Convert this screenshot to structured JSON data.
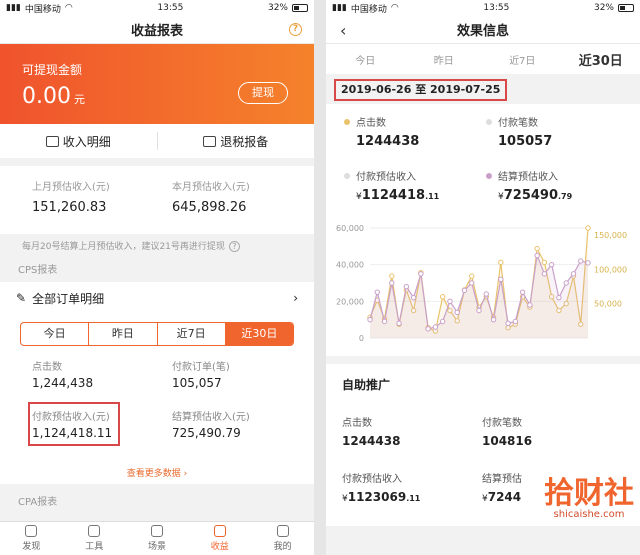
{
  "left": {
    "status": {
      "carrier": "中国移动",
      "time": "13:55",
      "battery": "32%"
    },
    "title": "收益报表",
    "help_icon": "question-circle-icon",
    "banner": {
      "label": "可提现金额",
      "amount": "0.00",
      "unit": "元",
      "button": "提现"
    },
    "links": [
      {
        "label": "收入明细",
        "icon": "wallet-icon"
      },
      {
        "label": "退税报备",
        "icon": "mail-icon"
      }
    ],
    "estimate": {
      "last_month_label": "上月预估收入(元)",
      "last_month_value": "151,260.83",
      "this_month_label": "本月预估收入(元)",
      "this_month_value": "645,898.26"
    },
    "note": "每月20号结算上月预估收入，建议21号再进行提现",
    "cps_label": "CPS报表",
    "all_orders": "全部订单明细",
    "tabs": [
      "今日",
      "昨日",
      "近7日",
      "近30日"
    ],
    "active_tab": 3,
    "stats": {
      "clicks_label": "点击数",
      "clicks": "1,244,438",
      "orders_label": "付款订单(笔)",
      "orders": "105,057",
      "pay_income_label": "付款预估收入(元)",
      "pay_income": "1,124,418.11",
      "settle_income_label": "结算预估收入(元)",
      "settle_income": "725,490.79"
    },
    "more": "查看更多数据",
    "cpa_label": "CPA报表",
    "tabbar": [
      {
        "label": "发现",
        "icon": "compass-icon"
      },
      {
        "label": "工具",
        "icon": "toolbox-icon"
      },
      {
        "label": "场景",
        "icon": "grid-icon"
      },
      {
        "label": "收益",
        "icon": "chart-icon"
      },
      {
        "label": "我的",
        "icon": "user-icon"
      }
    ],
    "active_tabbar": 3
  },
  "right": {
    "status": {
      "carrier": "中国移动",
      "time": "13:55",
      "battery": "32%"
    },
    "title": "效果信息",
    "tabs": [
      "今日",
      "昨日",
      "近7日",
      "近30日"
    ],
    "active_tab": 3,
    "date_range": "2019-06-26 至 2019-07-25",
    "metrics": {
      "clicks_label": "点击数",
      "clicks": "1244438",
      "orders_label": "付款笔数",
      "orders": "105057",
      "pay_label": "付款预估收入",
      "pay_int": "1124418",
      "pay_dec": ".11",
      "settle_label": "结算预估收入",
      "settle_int": "725490",
      "settle_dec": ".79",
      "currency": "¥"
    },
    "self_promo": {
      "title": "自助推广",
      "clicks_label": "点击数",
      "clicks": "1244438",
      "orders_label": "付款笔数",
      "orders": "104816",
      "pay_label": "付款预估收入",
      "pay_int": "1123069",
      "pay_dec": ".11",
      "settle_label": "结算预估",
      "settle_int": "7244",
      "currency": "¥"
    },
    "watermark": {
      "big": "拾财社",
      "small": "shicaishe.com"
    }
  },
  "colors": {
    "accent": "#f0642d",
    "highlight": "#d94848",
    "orange": "#e9a23b",
    "purple": "#c9a0c9"
  },
  "chart_data": {
    "type": "line",
    "left_axis": {
      "ticks": [
        "60,000",
        "40,000",
        "20,000",
        "0"
      ],
      "ylim": [
        0,
        60000
      ]
    },
    "right_axis": {
      "ticks": [
        "150,000",
        "100,000",
        "50,000"
      ],
      "ylim": [
        0,
        160000
      ]
    },
    "series": [
      {
        "name": "点击数",
        "color": "#e9c26a",
        "axis": "right",
        "values": [
          30000,
          55000,
          28000,
          90000,
          20000,
          70000,
          40000,
          95000,
          15000,
          10000,
          60000,
          40000,
          25000,
          70000,
          90000,
          45000,
          60000,
          30000,
          110000,
          15000,
          20000,
          60000,
          45000,
          130000,
          110000,
          60000,
          40000,
          50000,
          90000,
          20000,
          160000
        ]
      },
      {
        "name": "结算预估收入",
        "color": "#c9a0c9",
        "axis": "left",
        "values": [
          10000,
          25000,
          9000,
          30000,
          8000,
          28000,
          22000,
          35000,
          5000,
          6000,
          9000,
          20000,
          14000,
          26000,
          30000,
          15000,
          24000,
          10000,
          32000,
          8000,
          9000,
          25000,
          18000,
          45000,
          35000,
          40000,
          22000,
          30000,
          35000,
          42000,
          41000
        ]
      }
    ]
  }
}
